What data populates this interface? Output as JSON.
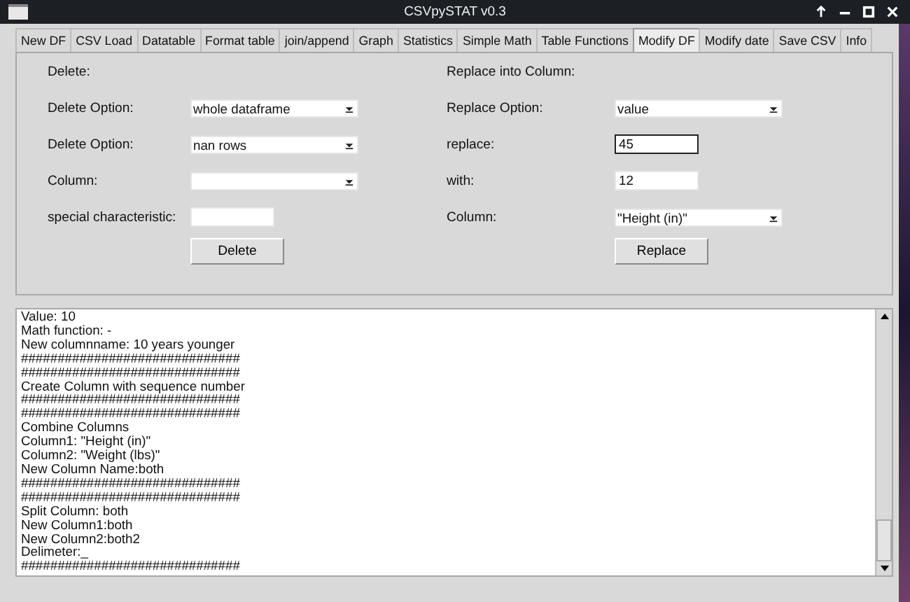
{
  "window": {
    "title": "CSVpySTAT v0.3"
  },
  "tabs": [
    {
      "label": "New DF",
      "selected": false
    },
    {
      "label": "CSV Load",
      "selected": false
    },
    {
      "label": "Datatable",
      "selected": false
    },
    {
      "label": "Format table",
      "selected": false
    },
    {
      "label": "join/append",
      "selected": false
    },
    {
      "label": "Graph",
      "selected": false
    },
    {
      "label": "Statistics",
      "selected": false
    },
    {
      "label": "Simple Math",
      "selected": false
    },
    {
      "label": "Table Functions",
      "selected": false
    },
    {
      "label": "Modify DF",
      "selected": true
    },
    {
      "label": "Modify date",
      "selected": false
    },
    {
      "label": "Save CSV",
      "selected": false
    },
    {
      "label": "Info",
      "selected": false
    }
  ],
  "sections": [
    {
      "heading": "Delete:",
      "fields": [
        {
          "kind": "combobox",
          "label": "Delete Option:",
          "value": "whole dataframe",
          "focused": false
        },
        {
          "kind": "combobox",
          "label": "Delete Option:",
          "value": "nan rows",
          "focused": false
        },
        {
          "kind": "combobox",
          "label": "Column:",
          "focused": false
        },
        {
          "kind": "entry",
          "label": "special characteristic:",
          "focused": false
        }
      ],
      "button": "Delete"
    },
    {
      "heading": "Replace into Column:",
      "fields": [
        {
          "kind": "combobox",
          "label": "Replace Option:",
          "value": "value",
          "focused": false
        },
        {
          "kind": "entry",
          "label": "replace:",
          "value": "45",
          "focused": true
        },
        {
          "kind": "entry",
          "label": "with:",
          "value": "12",
          "focused": false
        },
        {
          "kind": "combobox",
          "label": "Column:",
          "value": "\"Height (in)\"",
          "focused": false
        }
      ],
      "button": "Replace"
    }
  ],
  "log": [
    "Value: 10",
    "Math function: -",
    "New columnname: 10 years younger",
    "##############################",
    "##############################",
    "Create Column with sequence number",
    "##############################",
    "##############################",
    "Combine Columns",
    "Column1: \"Height (in)\"",
    "Column2: \"Weight (lbs)\"",
    "New Column Name:both",
    "##############################",
    "##############################",
    "Split Column: both",
    "New Column1:both",
    "New Column2:both2",
    "Delimeter:_",
    "##############################"
  ]
}
